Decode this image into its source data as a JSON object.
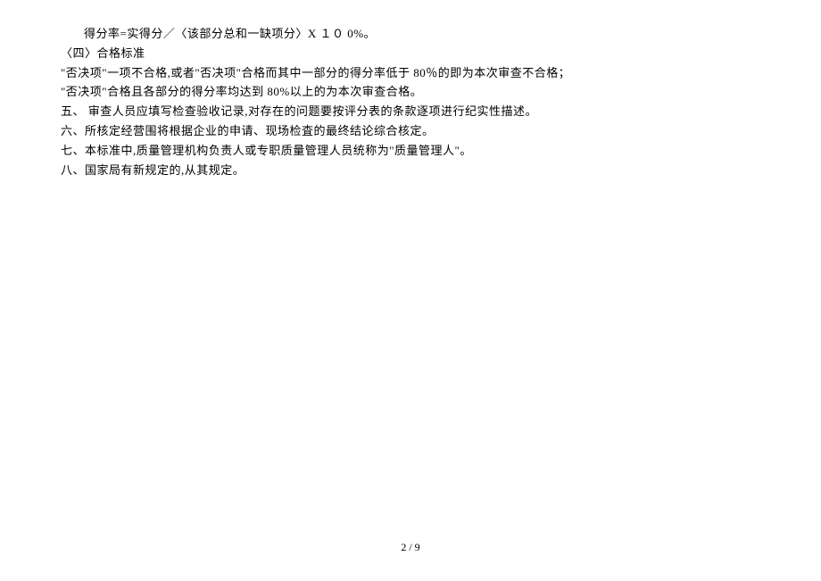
{
  "document": {
    "lines": [
      {
        "text": "得分率=实得分／〈该部分总和一缺项分〉X １０ 0%。",
        "indent": true
      },
      {
        "text": "〈四〉合格标准",
        "indent": false
      },
      {
        "text": "\"否决项\"一项不合格,或者\"否决项\"合格而其中一部分的得分率低于 80％的即为本次审查不合格；",
        "indent": false
      },
      {
        "text": "\"否决项\"合格且各部分的得分率均达到 80%以上的为本次审查合格。",
        "indent": false
      },
      {
        "text": "五、 审查人员应填写检查验收记录,对存在的问题要按评分表的条款逐项进行纪实性描述。",
        "indent": false
      },
      {
        "text": "六、所核定经营围将根据企业的申请、现场检査的最终结论综合核定。",
        "indent": false
      },
      {
        "text": "七、本标准中,质量管理机构负责人或专职质量管理人员统称为\"质量管理人\"。",
        "indent": false
      },
      {
        "text": "八、国家局有新规定的,从其规定。",
        "indent": false
      }
    ]
  },
  "page": {
    "current": "2",
    "total": "9",
    "separator": " / "
  }
}
